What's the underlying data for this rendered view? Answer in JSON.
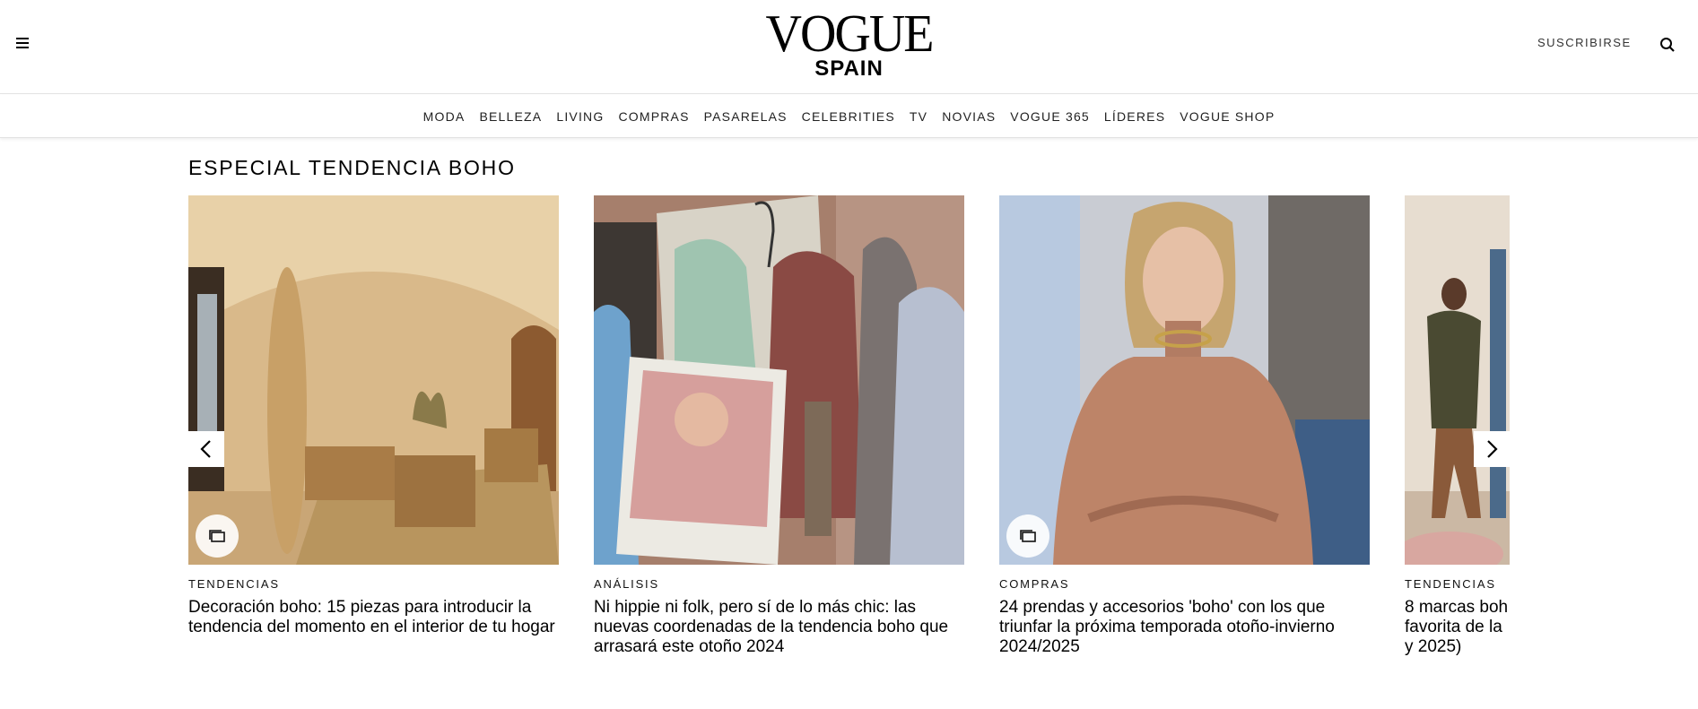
{
  "header": {
    "logo_main": "VOGUE",
    "logo_sub": "SPAIN",
    "subscribe_label": "SUSCRIBIRSE"
  },
  "nav": {
    "items": [
      "MODA",
      "BELLEZA",
      "LIVING",
      "COMPRAS",
      "PASARELAS",
      "CELEBRITIES",
      "TV",
      "NOVIAS",
      "VOGUE 365",
      "LÍDERES",
      "VOGUE SHOP"
    ]
  },
  "section": {
    "title": "ESPECIAL TENDENCIA BOHO"
  },
  "cards": [
    {
      "category": "TENDENCIAS",
      "title": "Decoración boho: 15 piezas para introducir la tendencia del momento en el interior de tu hogar",
      "gallery": true
    },
    {
      "category": "ANÁLISIS",
      "title": "Ni hippie ni folk, pero sí de lo más chic: las nuevas coordenadas de la tendencia boho que arrasará este otoño 2024",
      "gallery": false
    },
    {
      "category": "COMPRAS",
      "title": "24 prendas y accesorios 'boho' con los que triunfar la próxima temporada otoño-invierno 2024/2025",
      "gallery": true
    },
    {
      "category": "TENDENCIAS",
      "title": "8 marcas boh favorita de la y 2025)",
      "gallery": false
    }
  ],
  "icons": {
    "menu": "hamburger-icon",
    "search": "search-icon",
    "prev": "chevron-left-icon",
    "next": "chevron-right-icon",
    "gallery": "gallery-icon"
  }
}
